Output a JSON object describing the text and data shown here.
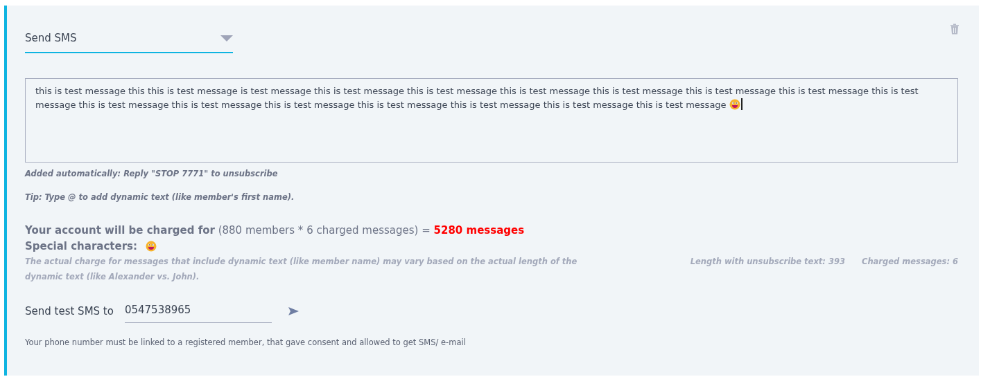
{
  "action_select": {
    "value": "Send SMS"
  },
  "message": {
    "value": "this is test message this this is test message  is test message this is test message this is test message this is test message this is test message this is test message this is test message this is test message this is test message this is test message this is test message this is test message this is test message this is test message this is test message",
    "has_emoji": true
  },
  "auto_note": "Added automatically: Reply \"STOP 7771\" to unsubscribe",
  "tip": "Tip: Type @ to add dynamic text (like member's first name).",
  "charge": {
    "label": "Your account will be charged for",
    "formula": "(880 members * 6 charged messages) =",
    "total": "5280 messages"
  },
  "special_characters": {
    "label": "Special characters:",
    "has_emoji": true
  },
  "charge_note": "The actual charge for messages that include dynamic text (like member name) may vary based on the actual length of the dynamic text (like Alexander vs. John).",
  "length_info": "Length with unsubscribe text: 393",
  "charged_info": "Charged messages: 6",
  "test_sms": {
    "label": "Send test SMS to",
    "value": "0547538965"
  },
  "phone_note": "Your phone number must be linked to a registered member, that gave consent and allowed to get SMS/ e-mail"
}
